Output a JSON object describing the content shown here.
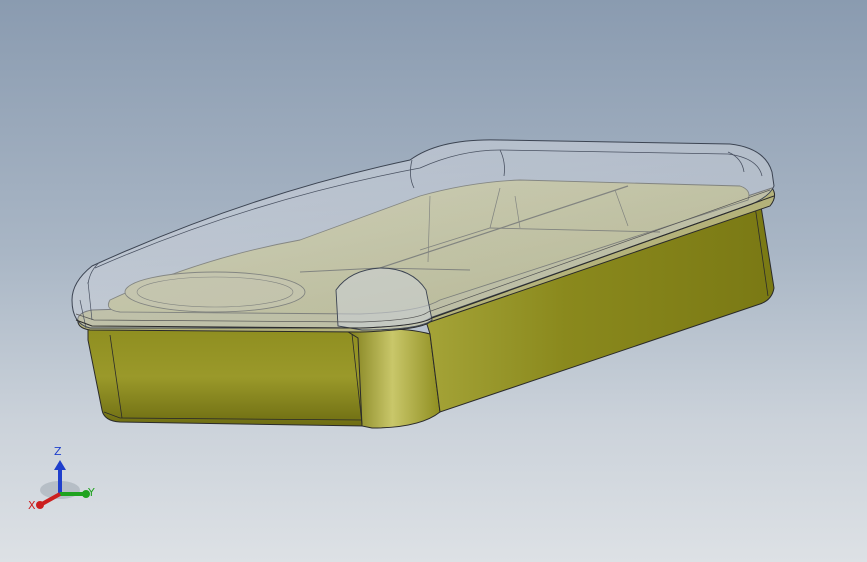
{
  "viewport": {
    "background_top": "#8a9bb0",
    "background_bottom": "#dde1e5"
  },
  "model": {
    "body_color": "#8a8a1c",
    "body_highlight": "#a6a535",
    "body_shadow": "#6b6b10",
    "lid_color": "#c9cfd8",
    "edge_color": "#2a2a2a"
  },
  "triad": {
    "x_label": "X",
    "y_label": "Y",
    "z_label": "Z",
    "x_color": "#cc1f1f",
    "y_color": "#1fa31f",
    "z_color": "#1f3fcc"
  }
}
